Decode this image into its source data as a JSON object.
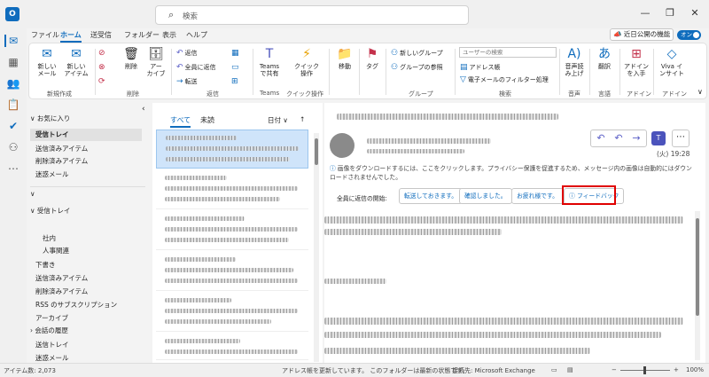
{
  "titlebar": {
    "search_placeholder": "検索"
  },
  "menu": {
    "tabs": [
      "ファイル",
      "ホーム",
      "送受信",
      "フォルダー",
      "表示",
      "ヘルプ"
    ],
    "new_features": "近日公開の機能",
    "toggle": "オン"
  },
  "ribbon": {
    "new_mail": "新しい\nメール",
    "new_item": "新しい\nアイテム",
    "delete": "削除",
    "archive": "アー\nカイブ",
    "reply": "返信",
    "reply_all": "全員に返信",
    "forward": "転送",
    "teams": "Teams\nで共有",
    "quick": "クイック\n操作",
    "move": "移動",
    "tag": "タグ",
    "new_group": "新しいグループ",
    "browse_group": "グループの参照",
    "search_user": "ユーザーの検索",
    "address_book": "アドレス帳",
    "filter": "電子メールのフィルター処理",
    "read_aloud": "音声読\nみ上げ",
    "translate": "翻訳",
    "addins": "アドイン\nを入手",
    "viva": "Viva イ\nンサイト",
    "groups": {
      "new": "新規作成",
      "delete": "削除",
      "reply": "返信",
      "teams": "Teams",
      "quick": "クイック操作",
      "group": "グループ",
      "search": "検索",
      "voice": "音声",
      "lang": "言語",
      "addin": "アドイン",
      "addin2": "アドイン"
    }
  },
  "folders": {
    "favorites": "お気に入り",
    "fav_items": [
      "受信トレイ",
      "送信済みアイテム",
      "削除済みアイテム",
      "迷惑メール"
    ],
    "inbox": "受信トレイ",
    "sub": [
      "社内",
      "人事関連"
    ],
    "others": [
      "下書き",
      "送信済みアイテム",
      "削除済みアイテム",
      "RSS のサブスクリプション",
      "アーカイブ",
      "会話の履歴",
      "送信トレイ",
      "迷惑メール"
    ]
  },
  "list": {
    "tab_all": "すべて",
    "tab_unread": "未読",
    "sort": "日付 ∨",
    "sort_dir": "↑"
  },
  "reading": {
    "date": "(火) 19:28",
    "info": "画像をダウンロードするには、ここをクリックします。プライバシー保護を促進するため、メッセージ内の画像は自動的にはダウンロードされませんでした。",
    "reply_label": "全員に返信の開始:",
    "suggestions": [
      "転送しておきます。",
      "確認しました。",
      "お疲れ様です。",
      "フィードバック"
    ]
  },
  "status": {
    "items": "アイテム数: 2,073",
    "update": "アドレス帳を更新しています。 このフォルダーは最新の状態です。",
    "connect": "接続先: Microsoft Exchange",
    "zoom": "100%"
  },
  "colors": {
    "accent": "#0f6cbd",
    "highlight": "#e00000"
  }
}
